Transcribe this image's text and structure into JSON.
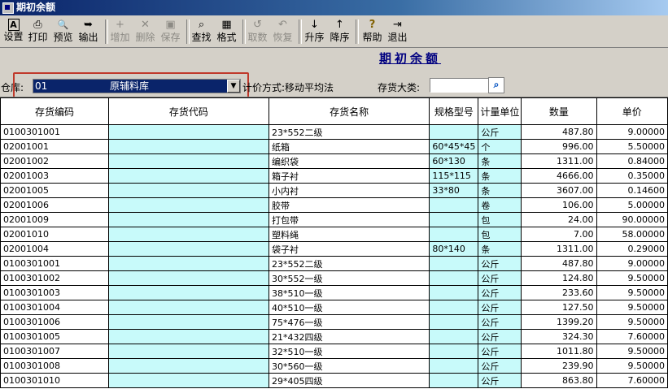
{
  "window": {
    "title": "期初余额"
  },
  "toolbar": {
    "buttons": [
      {
        "label": "设置",
        "icon": "A",
        "enabled": true
      },
      {
        "label": "打印",
        "icon": "⎙",
        "enabled": true
      },
      {
        "label": "预览",
        "icon": "🔍",
        "enabled": true
      },
      {
        "label": "输出",
        "icon": "➥",
        "enabled": true
      },
      {
        "label": "增加",
        "icon": "+",
        "enabled": false
      },
      {
        "label": "删除",
        "icon": "✕",
        "enabled": false
      },
      {
        "label": "保存",
        "icon": "▣",
        "enabled": false
      },
      {
        "label": "查找",
        "icon": "⌕",
        "enabled": true
      },
      {
        "label": "格式",
        "icon": "▦",
        "enabled": true
      },
      {
        "label": "取数",
        "icon": "↺",
        "enabled": false
      },
      {
        "label": "恢复",
        "icon": "↶",
        "enabled": false
      },
      {
        "label": "升序",
        "icon": "↓",
        "enabled": true
      },
      {
        "label": "降序",
        "icon": "↑",
        "enabled": true
      },
      {
        "label": "帮助",
        "icon": "?",
        "enabled": true
      },
      {
        "label": "退出",
        "icon": "⇥",
        "enabled": true
      }
    ]
  },
  "heading": "期初余额",
  "filters": {
    "warehouse_label": "仓库:",
    "warehouse_code": "01",
    "warehouse_name": "原辅料库",
    "valuation_label": "计价方式:移动平均法",
    "category_label": "存货大类:",
    "category_value": ""
  },
  "table": {
    "columns": [
      "存货编码",
      "存货代码",
      "存货名称",
      "规格型号",
      "计量单位",
      "数量",
      "单价"
    ],
    "rows": [
      [
        "0100301001",
        "",
        "23*552二级",
        "",
        "公斤",
        "487.80",
        "9.00000"
      ],
      [
        "02001001",
        "",
        "纸箱",
        "60*45*45",
        "个",
        "996.00",
        "5.50000"
      ],
      [
        "02001002",
        "",
        "编织袋",
        "60*130",
        "条",
        "1311.00",
        "0.84000"
      ],
      [
        "02001003",
        "",
        "箱子衬",
        "115*115",
        "条",
        "4666.00",
        "0.35000"
      ],
      [
        "02001005",
        "",
        "小内衬",
        "33*80",
        "条",
        "3607.00",
        "0.14600"
      ],
      [
        "02001006",
        "",
        "胶带",
        "",
        "卷",
        "106.00",
        "5.00000"
      ],
      [
        "02001009",
        "",
        "打包带",
        "",
        "包",
        "24.00",
        "90.00000"
      ],
      [
        "02001010",
        "",
        "塑料绳",
        "",
        "包",
        "7.00",
        "58.00000"
      ],
      [
        "02001004",
        "",
        "袋子衬",
        "80*140",
        "条",
        "1311.00",
        "0.29000"
      ],
      [
        "0100301001",
        "",
        "23*552二级",
        "",
        "公斤",
        "487.80",
        "9.00000"
      ],
      [
        "0100301002",
        "",
        "30*552一级",
        "",
        "公斤",
        "124.80",
        "9.50000"
      ],
      [
        "0100301003",
        "",
        "38*510一级",
        "",
        "公斤",
        "233.60",
        "9.50000"
      ],
      [
        "0100301004",
        "",
        "40*510一级",
        "",
        "公斤",
        "127.50",
        "9.50000"
      ],
      [
        "0100301006",
        "",
        "75*476一级",
        "",
        "公斤",
        "1399.20",
        "9.50000"
      ],
      [
        "0100301005",
        "",
        "21*432四级",
        "",
        "公斤",
        "324.30",
        "7.60000"
      ],
      [
        "0100301007",
        "",
        "32*510一级",
        "",
        "公斤",
        "1011.80",
        "9.50000"
      ],
      [
        "0100301008",
        "",
        "30*560一级",
        "",
        "公斤",
        "239.90",
        "9.50000"
      ],
      [
        "0100301010",
        "",
        "29*405四级",
        "",
        "公斤",
        "863.80",
        "7.60000"
      ]
    ]
  }
}
